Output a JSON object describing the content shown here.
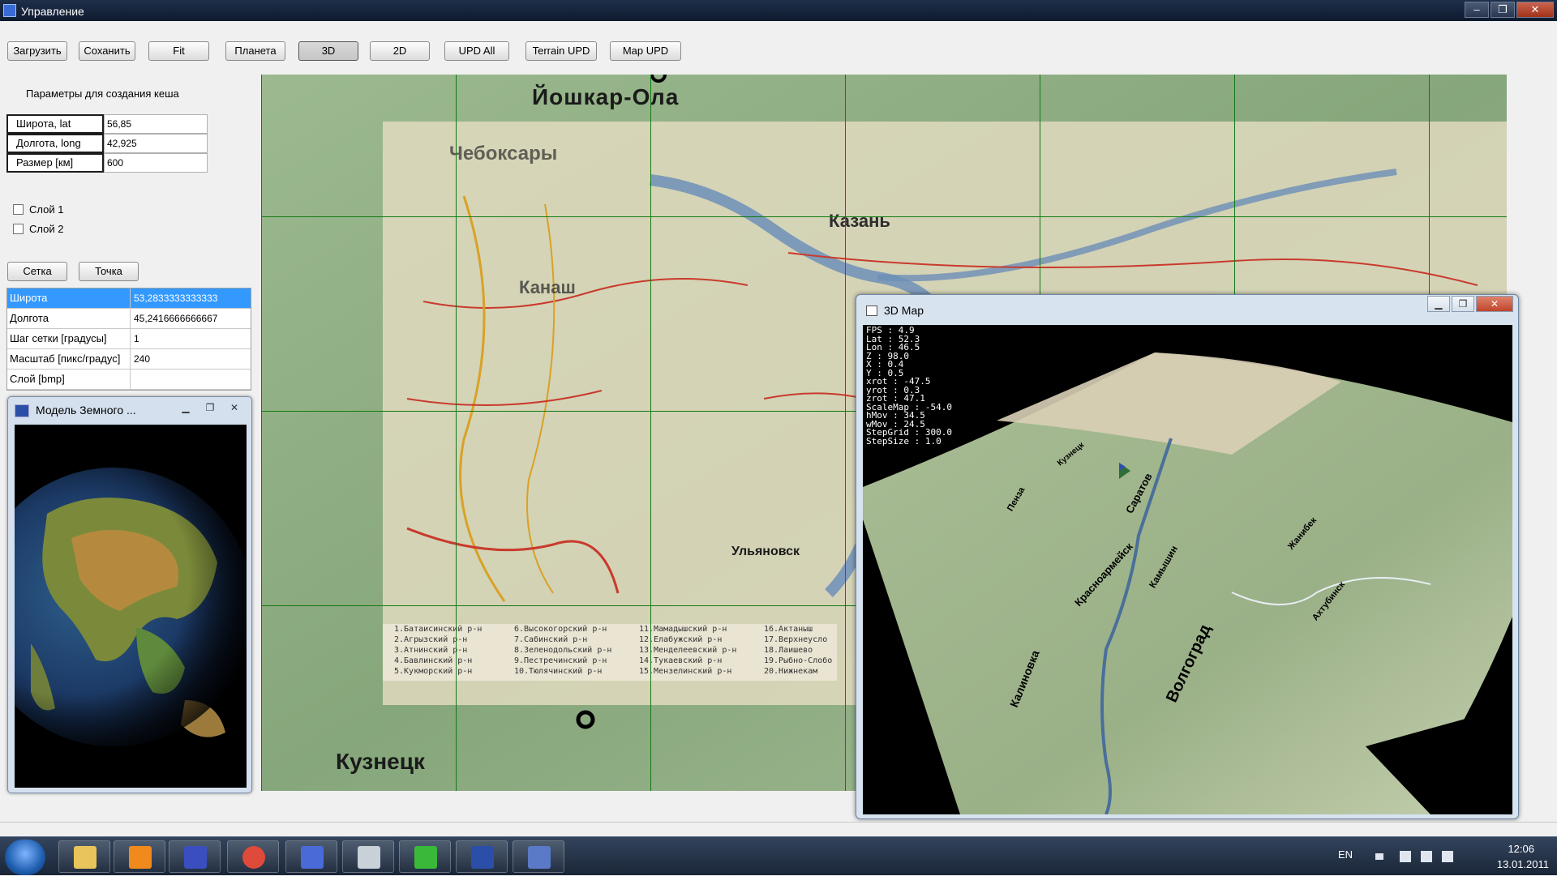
{
  "window": {
    "title": "Управление"
  },
  "toolbar": {
    "buttons": [
      "Загрузить",
      "Соханить",
      "Fit",
      "Планета",
      "3D",
      "2D",
      "UPD All",
      "Terrain UPD",
      "Map UPD"
    ]
  },
  "cache_params": {
    "title": "Параметры для создания кеша",
    "lat_label": "Широта, lat",
    "lat_value": "56,85",
    "lon_label": "Долгота, long",
    "lon_value": "42,925",
    "size_label": "Размер [км]",
    "size_value": "600"
  },
  "layers": {
    "layer1": "Слой 1",
    "layer2": "Слой 2"
  },
  "grid_buttons": {
    "grid": "Сетка",
    "point": "Точка"
  },
  "props": [
    {
      "key": "Широта",
      "value": "53,2833333333333"
    },
    {
      "key": "Долгота",
      "value": "45,2416666666667"
    },
    {
      "key": "Шаг сетки [градусы]",
      "value": "1"
    },
    {
      "key": "Масштаб [пикс/градус]",
      "value": "240"
    },
    {
      "key": "Слой [bmp]",
      "value": ""
    }
  ],
  "earth_window": {
    "title": "Модель Земного ..."
  },
  "map": {
    "city_labels": [
      "Йошкар-Ола",
      "Чебоксары",
      "Казань",
      "Канаш",
      "Ульяновск",
      "Кузнецк"
    ],
    "legend": [
      "1.Батаисинский р-н",
      "2.Агрызский р-н",
      "3.Атнинский р-н",
      "4.Бавлинский р-н",
      "5.Кукморский р-н",
      "6.Высокогорский р-н",
      "7.Сабинский р-н",
      "8.Зеленодольский р-н",
      "9.Пестречинский р-н",
      "10.Тюлячинский р-н",
      "11.Мамадышский р-н",
      "12.Елабужский р-н",
      "13.Менделеевский р-н",
      "14.Тукаевский р-н",
      "15.Мензелинский р-н",
      "16.Актаныш",
      "17.Верхнеусло",
      "18.Лаишево",
      "19.Рыбно-Слобо",
      "20.Нижнекам"
    ]
  },
  "map3d_window": {
    "title": "3D Map",
    "stats": [
      {
        "k": "FPS",
        "v": "4.9"
      },
      {
        "k": "Lat",
        "v": "52.3"
      },
      {
        "k": "Lon",
        "v": "46.5"
      },
      {
        "k": "Z",
        "v": "98.0"
      },
      {
        "k": "X",
        "v": "0.4"
      },
      {
        "k": "Y",
        "v": "0.5"
      },
      {
        "k": "xrot",
        "v": "-47.5"
      },
      {
        "k": "yrot",
        "v": "0.3"
      },
      {
        "k": "zrot",
        "v": "47.1"
      },
      {
        "k": "ScaleMap",
        "v": "-54.0"
      },
      {
        "k": "hMov",
        "v": "34.5"
      },
      {
        "k": "wMov",
        "v": "24.5"
      },
      {
        "k": "StepGrid",
        "v": "300.0"
      },
      {
        "k": "StepSize",
        "v": "1.0"
      }
    ],
    "terrain_labels": [
      "Саратов",
      "Волгоград",
      "Красноармейск",
      "Камышин",
      "Жанибек",
      "Ахтубинск",
      "Калиновка",
      "Пенза",
      "Кузнецк"
    ]
  },
  "taskbar": {
    "lang": "EN",
    "time": "12:06",
    "date": "13.01.2011"
  },
  "colors": {
    "selection": "#3399ff",
    "grid_line": "#137a13",
    "titlebar": "#1f2f4a"
  }
}
